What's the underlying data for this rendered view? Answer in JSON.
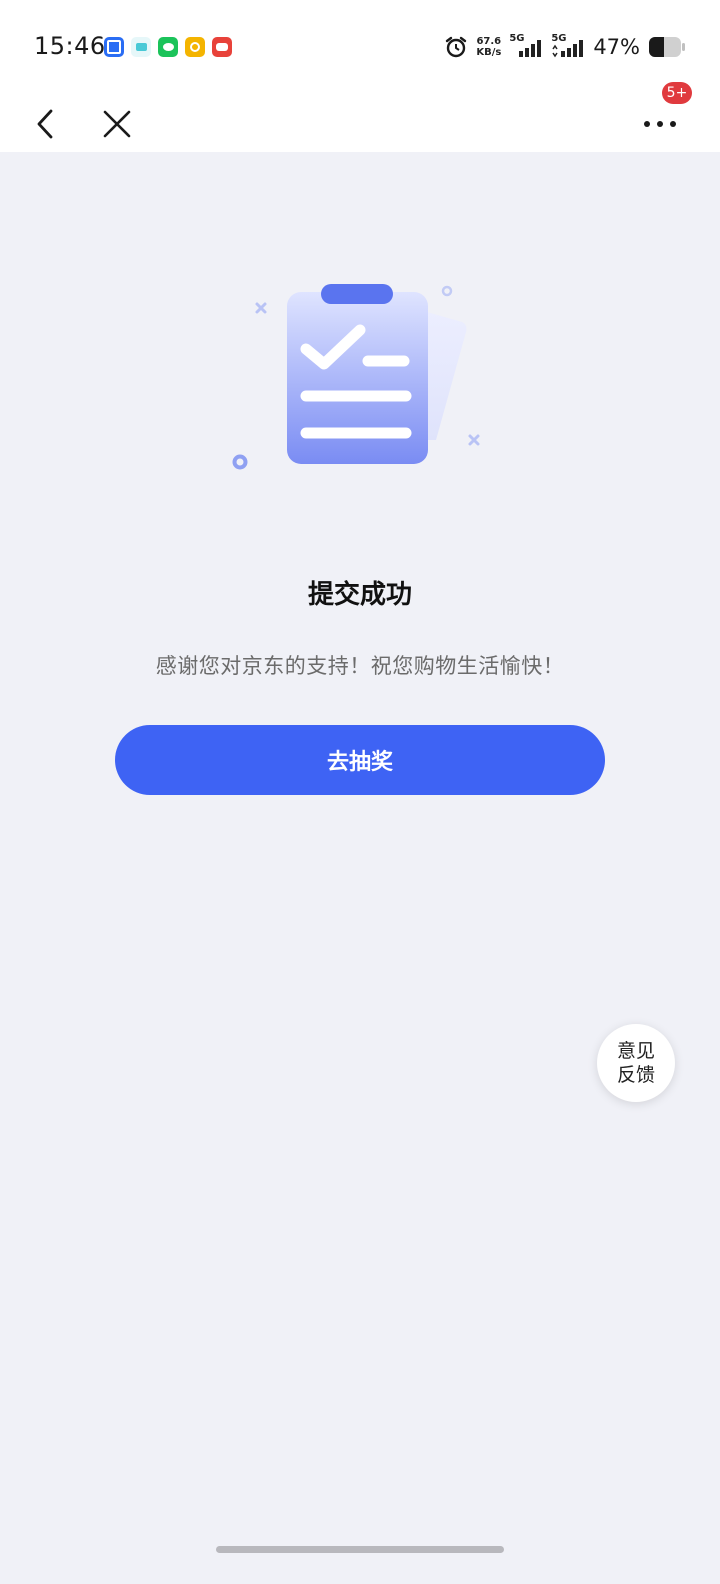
{
  "status_bar": {
    "time": "15:46",
    "net_speed_value": "67.6",
    "net_speed_unit": "KB/s",
    "signal_1_label": "5G",
    "signal_2_label": "5G",
    "battery_percent": "47%",
    "notification_icons": [
      "jd-app-icon",
      "message-icon",
      "wechat-icon",
      "wallet-icon",
      "game-icon"
    ]
  },
  "nav": {
    "more_badge": "5+"
  },
  "result": {
    "title": "提交成功",
    "message": "感谢您对京东的支持！祝您购物生活愉快！",
    "button_label": "去抽奖"
  },
  "feedback": {
    "line1": "意见",
    "line2": "反馈"
  },
  "colors": {
    "accent": "#3e63f4",
    "badge": "#e03a3e",
    "page_background": "#f0f1f7"
  }
}
